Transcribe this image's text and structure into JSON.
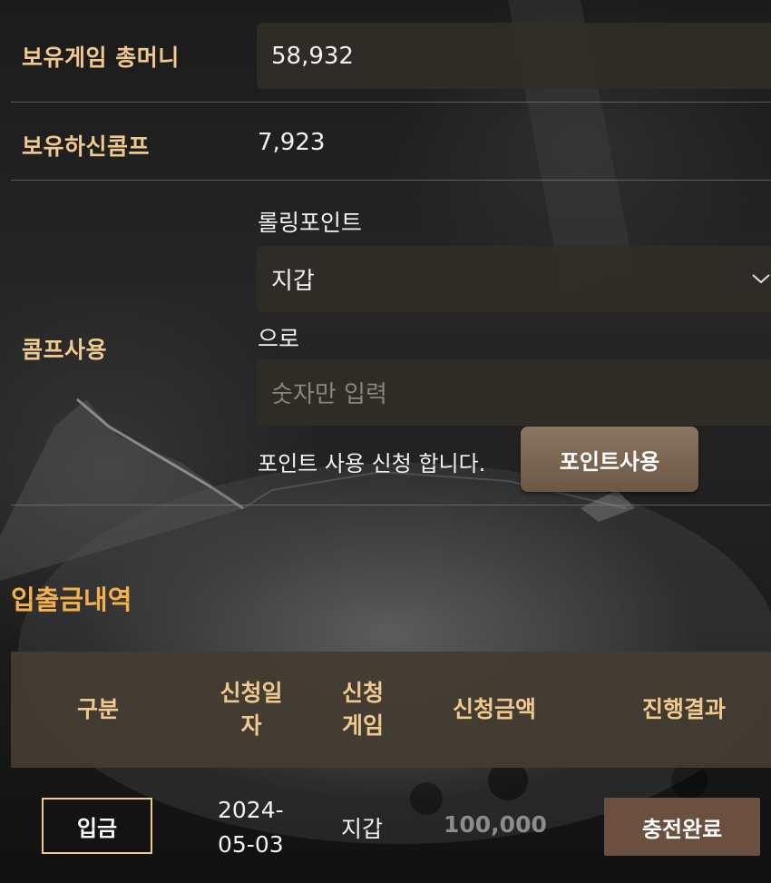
{
  "holdings": {
    "money_label": "보유게임 총머니",
    "money_value": "58,932",
    "comp_label": "보유하신콤프",
    "comp_value": "7,923"
  },
  "comp_use": {
    "label": "콤프사용",
    "source_label": "롤링포인트",
    "target_select": "지갑",
    "suffix_label": "으로",
    "amount_placeholder": "숫자만 입력",
    "request_text": "포인트 사용 신청 합니다.",
    "submit_button": "포인트사용"
  },
  "history": {
    "title": "입출금내역",
    "columns": [
      "구분",
      "신청일\n자",
      "신청\n게임",
      "신청금액",
      "진행결과"
    ],
    "rows": [
      {
        "type": "입금",
        "date": "2024-\n05-03",
        "game": "지갑",
        "amount": "100,000",
        "status": "충전완료"
      }
    ]
  },
  "colors": {
    "label_gold": "#f0c98e",
    "title_orange": "#f4b04a",
    "button_brown": "#6b5845",
    "status_brown": "#6b5040"
  },
  "icons": {
    "select_arrow": "chevron-down-icon"
  }
}
